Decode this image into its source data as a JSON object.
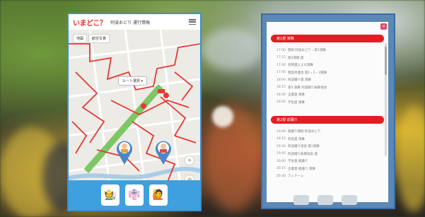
{
  "app": {
    "logo_text": "いまどこ？",
    "header_title": "阿波おどり 運行情報"
  },
  "map": {
    "tabs": [
      "地図",
      "航空写真"
    ],
    "select_label": "ルート選択 ▾",
    "controls": [
      "＋",
      "◎"
    ],
    "route_color": "#e53935",
    "parade_color": "#6abf4b"
  },
  "footer_characters": [
    "🧑‍🌾",
    "👘",
    "🙋"
  ],
  "schedule": {
    "section1_title": "第1部 演舞",
    "section1_items": [
      {
        "time": "17:00",
        "text": "開始 阿波おどり・第1演舞"
      },
      {
        "time": "17:15",
        "text": "第2演舞 連"
      },
      {
        "time": "17:30",
        "text": "名物連による演舞"
      },
      {
        "time": "17:45",
        "text": "徳島県連合 第1・2・3演舞"
      },
      {
        "time": "18:00",
        "text": "阿波踊り連 演舞"
      },
      {
        "time": "18:15",
        "text": "第3 演舞 阿波踊り振興協会"
      },
      {
        "time": "18:30",
        "text": "企業連 演舞"
      },
      {
        "time": "18:45",
        "text": "学生連 演舞"
      }
    ],
    "section2_title": "第2部 総踊り",
    "section2_items": [
      {
        "time": "19:00",
        "text": "総踊り開始 阿波おどり"
      },
      {
        "time": "19:15",
        "text": "有名連 演舞"
      },
      {
        "time": "19:30",
        "text": "阿波踊り協会 第1演舞"
      },
      {
        "time": "19:45",
        "text": "阿波踊り振興協会 連"
      },
      {
        "time": "20:00",
        "text": "学生連 総踊り"
      },
      {
        "time": "20:15",
        "text": "企業連 総踊り 演舞"
      },
      {
        "time": "20:30",
        "text": "フィナーレ"
      }
    ],
    "close_label": "×",
    "accent": "#e51c23"
  }
}
